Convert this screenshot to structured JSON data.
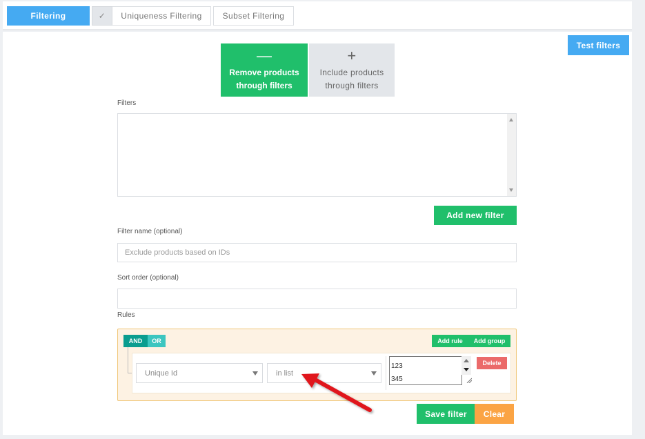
{
  "tabs": {
    "filtering": "Filtering",
    "check_icon": "✓",
    "uniqueness": "Uniqueness Filtering",
    "subset": "Subset Filtering"
  },
  "toolbar": {
    "test_filters": "Test filters"
  },
  "mode": {
    "remove_symbol": "—",
    "remove_label_1": "Remove products",
    "remove_label_2": "through filters",
    "include_symbol": "+",
    "include_label_1": "Include products",
    "include_label_2": "through filters"
  },
  "filters": {
    "label": "Filters",
    "add_button": "Add new filter"
  },
  "filter_name": {
    "label": "Filter name (optional)",
    "placeholder": "Exclude products based on IDs",
    "value": ""
  },
  "sort_order": {
    "label": "Sort order (optional)",
    "value": ""
  },
  "rules": {
    "label": "Rules",
    "and": "AND",
    "or": "OR",
    "add_rule": "Add rule",
    "add_group": "Add group",
    "rule": {
      "field": "Unique Id",
      "operator": "in list",
      "value_line_1": "123",
      "value_line_2": "345",
      "delete": "Delete"
    }
  },
  "actions": {
    "save": "Save filter",
    "clear": "Clear"
  },
  "colors": {
    "primary_blue": "#45aaf2",
    "green": "#20bf6b",
    "red": "#eb6a6a",
    "orange": "#fba444",
    "annotation_arrow": "#e0161b"
  },
  "icons": [
    "check-icon",
    "minus-icon",
    "plus-icon",
    "dropdown-caret-icon",
    "annotation-arrow-icon"
  ]
}
